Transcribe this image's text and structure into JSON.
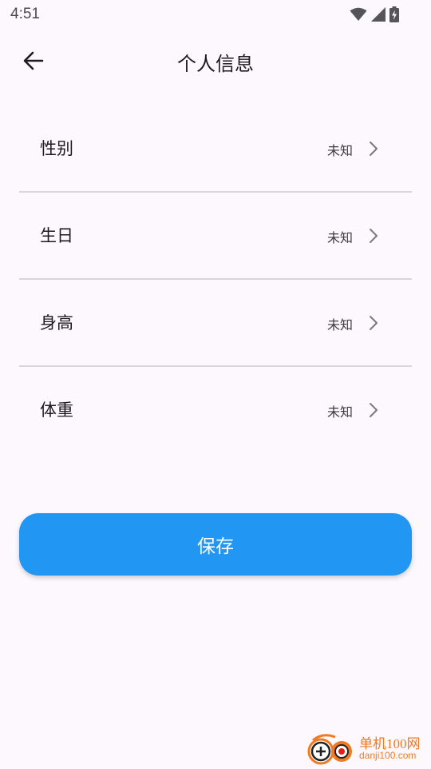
{
  "status_bar": {
    "time": "4:51",
    "icons": [
      "wifi-icon",
      "cellular-signal-icon",
      "battery-charging-icon"
    ]
  },
  "app_bar": {
    "title": "个人信息",
    "back_icon": "arrow-back-icon"
  },
  "profile_items": [
    {
      "label": "性别",
      "value": "未知"
    },
    {
      "label": "生日",
      "value": "未知"
    },
    {
      "label": "身高",
      "value": "未知"
    },
    {
      "label": "体重",
      "value": "未知"
    }
  ],
  "save_button": {
    "label": "保存"
  },
  "watermark": {
    "name": "单机100网",
    "url": "danji100.com"
  },
  "colors": {
    "background": "#fdf7fe",
    "primary_button": "#2196f3",
    "divider": "#d9d5db",
    "watermark": "#f07a22"
  }
}
